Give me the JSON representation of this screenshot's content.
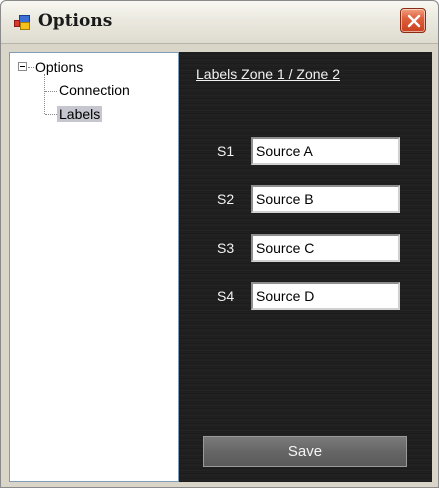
{
  "window": {
    "title": "Options",
    "close_icon": "close-icon"
  },
  "tree": {
    "root": {
      "label": "Options",
      "expanded": true
    },
    "children": [
      {
        "label": "Connection",
        "selected": false
      },
      {
        "label": "Labels",
        "selected": true
      }
    ]
  },
  "panel": {
    "heading": "Labels Zone 1 / Zone 2",
    "rows": [
      {
        "label": "S1",
        "value": "Source A"
      },
      {
        "label": "S2",
        "value": "Source B"
      },
      {
        "label": "S3",
        "value": "Source C"
      },
      {
        "label": "S4",
        "value": "Source D"
      }
    ],
    "save_label": "Save"
  },
  "colors": {
    "panel_background": "#1c1c1c",
    "tree_selection": "#c6c6cf",
    "close_button": "#d9502c"
  }
}
